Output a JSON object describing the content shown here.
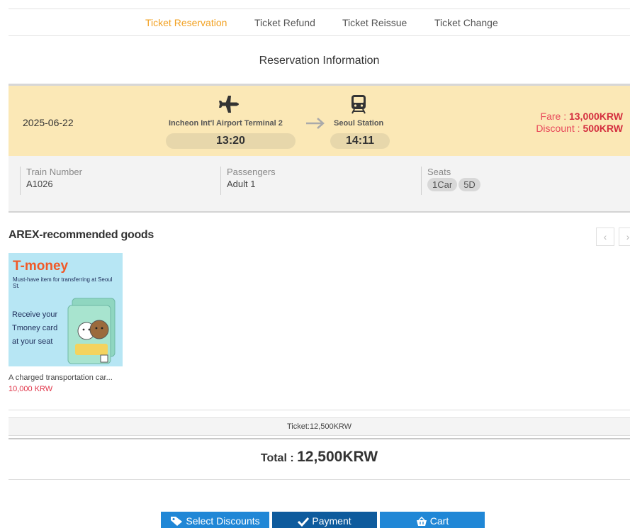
{
  "tabs": [
    {
      "label": "Ticket Reservation",
      "active": true
    },
    {
      "label": "Ticket Refund",
      "active": false
    },
    {
      "label": "Ticket Reissue",
      "active": false
    },
    {
      "label": "Ticket Change",
      "active": false
    }
  ],
  "section_title": "Reservation Information",
  "reservation": {
    "date": "2025-06-22",
    "from_station": "Incheon Int'l Airport Terminal 2",
    "from_time": "13:20",
    "to_station": "Seoul Station",
    "to_time": "14:11",
    "fare_label": "Fare : ",
    "fare_value": "13,000KRW",
    "discount_label": "Discount : ",
    "discount_value": "500KRW",
    "icons": {
      "from": "plane-icon",
      "to": "train-icon",
      "between": "arrow-right-icon"
    }
  },
  "details": {
    "train_number_label": "Train Number",
    "train_number": "A1026",
    "passengers_label": "Passengers",
    "passengers": "Adult 1",
    "seats_label": "Seats",
    "seat_car": "1Car",
    "seat_no": "5D"
  },
  "goods": {
    "title": "AREX-recommended goods",
    "items": [
      {
        "image_title": "T-money",
        "image_subtitle": "Must-have item for transferring at Seoul St.",
        "image_text_1": "Receive your",
        "image_text_2": "Tmoney card",
        "image_text_3": "at your seat",
        "name": "A charged transportation car...",
        "price": "10,000 KRW"
      }
    ]
  },
  "ticket_summary": "Ticket:12,500KRW",
  "total_label": "Total : ",
  "total_value": "12,500KRW",
  "buttons": {
    "discounts": "Select Discounts",
    "payment": "Payment",
    "cart": "Cart"
  },
  "colors": {
    "active_tab": "#f2a122",
    "reservation_band": "#fbe8b6",
    "fare_red": "#d42e3f",
    "primary_blue": "#2087d6",
    "payment_blue": "#0e5b9d"
  }
}
